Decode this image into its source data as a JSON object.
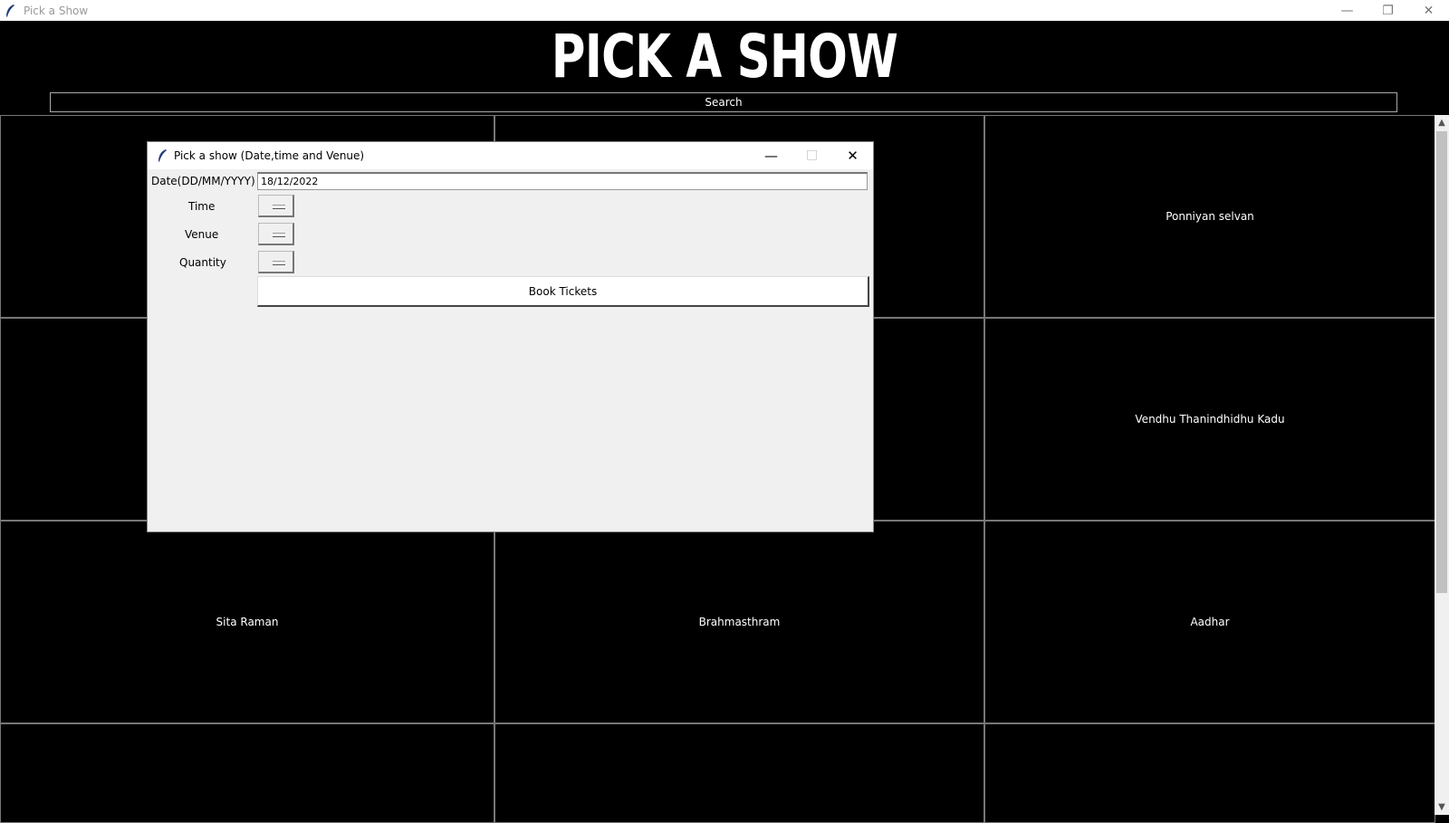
{
  "window": {
    "title": "Pick a Show",
    "controls": {
      "minimize": "—",
      "restore": "❐",
      "close": "✕"
    }
  },
  "app": {
    "heading": "PICK A SHOW",
    "search_label": "Search"
  },
  "movies": [
    "",
    "",
    "Ponniyan selvan",
    "",
    "",
    "Vendhu Thanindhidhu Kadu",
    "Sita Raman",
    "Brahmasthram",
    "Aadhar",
    "",
    "",
    ""
  ],
  "dialog": {
    "title": "Pick a show (Date,time and Venue)",
    "controls": {
      "minimize": "—",
      "maximize": "☐",
      "close": "✕"
    },
    "date_label": "Date(DD/MM/YYYY)",
    "date_value": "18/12/2022",
    "time_label": "Time",
    "venue_label": "Venue",
    "quantity_label": "Quantity",
    "book_label": "Book Tickets"
  },
  "colors": {
    "background": "#000000",
    "dialog_bg": "#f0f0f0",
    "text_light": "#ffffff"
  }
}
